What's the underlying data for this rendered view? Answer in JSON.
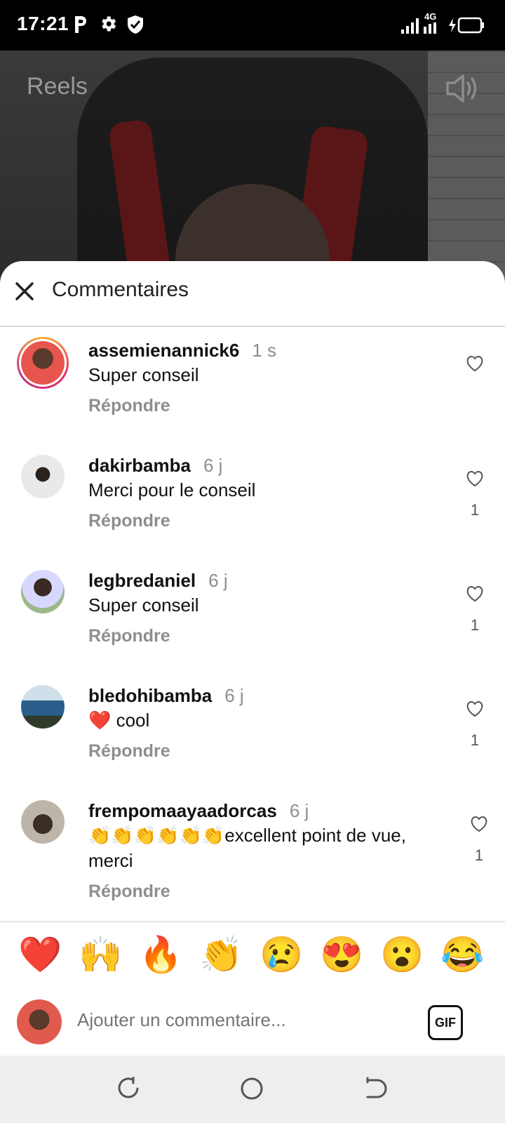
{
  "status": {
    "time": "17:21",
    "network": "4G"
  },
  "video": {
    "title": "Reels"
  },
  "sheet": {
    "title": "Commentaires"
  },
  "comments": [
    {
      "user": "assemienannick6",
      "time": "1 s",
      "text": "Super conseil",
      "reply": "Répondre",
      "likes": ""
    },
    {
      "user": "dakirbamba",
      "time": "6 j",
      "text": "Merci pour le conseil",
      "reply": "Répondre",
      "likes": "1"
    },
    {
      "user": "legbredaniel",
      "time": "6 j",
      "text": "Super conseil",
      "reply": "Répondre",
      "likes": "1"
    },
    {
      "user": "bledohibamba",
      "time": "6 j",
      "text": "❤️ cool",
      "reply": "Répondre",
      "likes": "1"
    },
    {
      "user": "frempomaayaadorcas",
      "time": "6 j",
      "text": "👏👏👏👏👏👏excellent point de vue, merci",
      "reply": "Répondre",
      "likes": "1"
    }
  ],
  "quick_reactions": [
    "❤️",
    "🙌",
    "🔥",
    "👏",
    "😢",
    "😍",
    "😮",
    "😂"
  ],
  "composer": {
    "placeholder": "Ajouter un commentaire...",
    "gif_label": "GIF"
  },
  "colors": {
    "reply_gray": "#8e8e8e",
    "story_ring": "#e1306c"
  }
}
